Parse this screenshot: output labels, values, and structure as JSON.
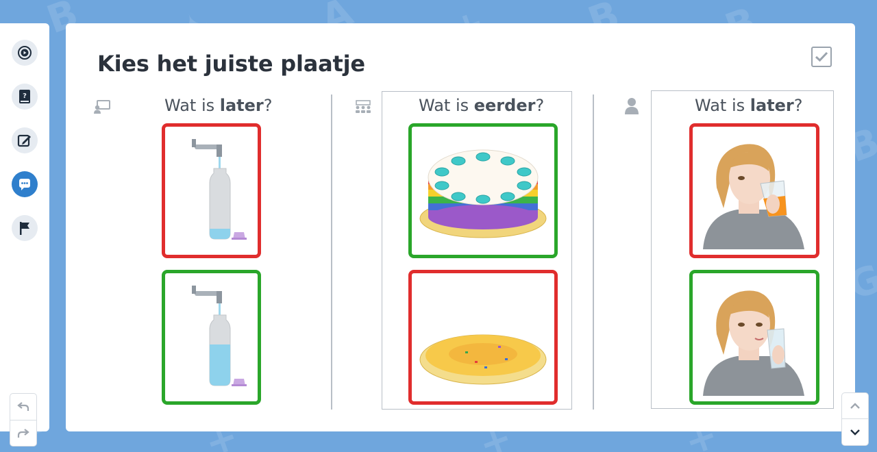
{
  "title": "Kies het juiste plaatje",
  "colors": {
    "accent": "#2f7fcc",
    "correct": "#2aa62a",
    "incorrect": "#e02d2d",
    "background": "#6fa6dd"
  },
  "sidebar": {
    "items": [
      {
        "icon": "play-circle-icon",
        "active": false
      },
      {
        "icon": "book-question-icon",
        "active": false
      },
      {
        "icon": "edit-icon",
        "active": false
      },
      {
        "icon": "chat-bubble-icon",
        "active": true
      },
      {
        "icon": "flag-icon",
        "active": false
      }
    ],
    "undo_icon": "undo-icon",
    "redo_icon": "redo-icon"
  },
  "columns": [
    {
      "icon": "teacher-board-icon",
      "question_prefix": "Wat is ",
      "question_key": "later",
      "question_suffix": "?",
      "options": [
        {
          "picture": "bottle-almost-empty",
          "state": "wrong"
        },
        {
          "picture": "bottle-half-full",
          "state": "correct"
        }
      ]
    },
    {
      "icon": "group-icon",
      "question_prefix": "Wat is ",
      "question_key": "eerder",
      "question_suffix": "?",
      "options": [
        {
          "picture": "rainbow-cake",
          "state": "correct"
        },
        {
          "picture": "flat-pancake",
          "state": "wrong"
        }
      ]
    },
    {
      "icon": "person-icon",
      "question_prefix": "Wat is ",
      "question_key": "later",
      "question_suffix": "?",
      "options": [
        {
          "picture": "woman-drinking-juice",
          "state": "wrong"
        },
        {
          "picture": "woman-drinking-water",
          "state": "correct"
        }
      ]
    }
  ],
  "scroll": {
    "up_icon": "chevron-up-icon",
    "down_icon": "chevron-down-icon"
  }
}
